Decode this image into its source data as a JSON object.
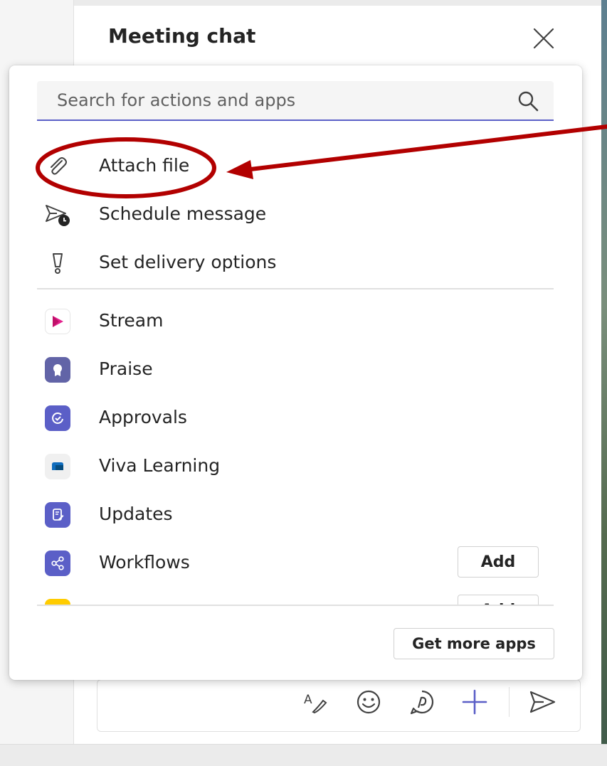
{
  "chat": {
    "title": "Meeting chat",
    "close_icon": "close-icon"
  },
  "actions_popup": {
    "search_placeholder": "Search for actions and apps",
    "search_icon": "search-icon",
    "actions": [
      {
        "label": "Attach file",
        "icon": "paperclip-icon"
      },
      {
        "label": "Schedule message",
        "icon": "send-clock-icon"
      },
      {
        "label": "Set delivery options",
        "icon": "important-icon"
      }
    ],
    "apps": [
      {
        "label": "Stream",
        "icon": "stream-app-icon",
        "color": "#ffffff"
      },
      {
        "label": "Praise",
        "icon": "praise-app-icon",
        "color": "#6264a7"
      },
      {
        "label": "Approvals",
        "icon": "approvals-app-icon",
        "color": "#5b5fc7"
      },
      {
        "label": "Viva Learning",
        "icon": "viva-learning-app-icon",
        "color": "#f0f0f0"
      },
      {
        "label": "Updates",
        "icon": "updates-app-icon",
        "color": "#5b5fc7"
      },
      {
        "label": "Workflows",
        "icon": "workflows-app-icon",
        "color": "#5b5fc7",
        "button": "Add"
      },
      {
        "label": "",
        "icon": "partial-app-icon",
        "color": "#ffcc00",
        "button": "Add"
      }
    ],
    "get_more_apps": "Get more apps"
  },
  "compose_toolbar": {
    "icons": [
      "format-icon",
      "emoji-icon",
      "loop-icon",
      "add-icon",
      "send-icon"
    ]
  },
  "colors": {
    "accent": "#5b5fc7",
    "annotation": "#b20000"
  }
}
